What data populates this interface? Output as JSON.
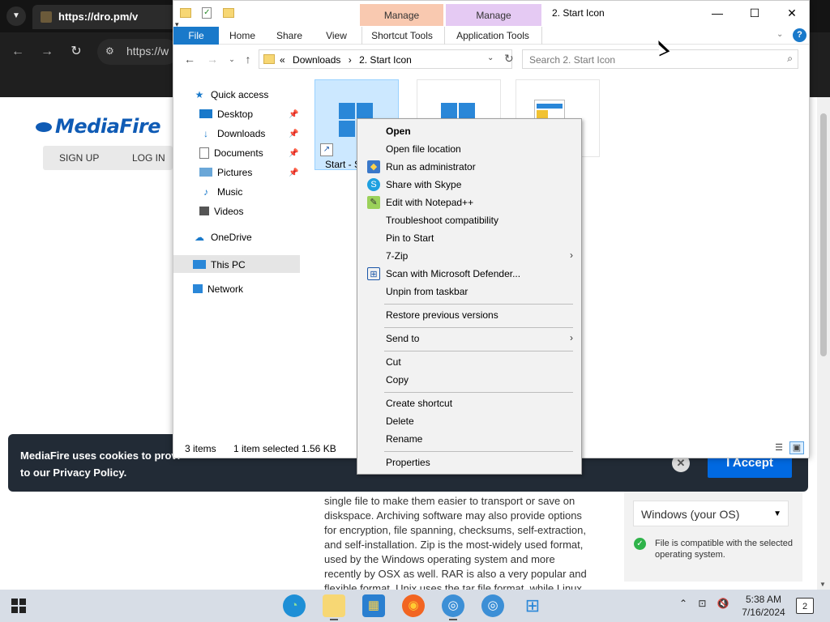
{
  "browser": {
    "tab_title": "https://dro.pm/v",
    "url": "https://w",
    "colors": {
      "tabbar": "#141414",
      "toolbar": "#1f1f1f"
    }
  },
  "mediafire": {
    "logo_text": "MediaFire",
    "nav": [
      "SIGN UP",
      "LOG IN"
    ],
    "article_lines": [
      "single file to make them easier to transport or save on",
      "diskspace. Archiving software may also provide options",
      "for encryption, file spanning, checksums, self-extraction,",
      "and self-installation. Zip is the most-widely used format,",
      "used by the Windows operating system and more",
      "recently by OSX as well. RAR is also a very popular and",
      "flexible format. Unix uses the tar file format, while Linux"
    ],
    "os_select": "Windows (your OS)",
    "os_note": "File is compatible with the selected operating system.",
    "cookie_text": "MediaFire uses cookies to provi... to our Privacy Policy.",
    "cookie_line1": "MediaFire uses cookies to provi",
    "cookie_line2": "to our Privacy Policy.",
    "accept_label": "I Accept",
    "colors": {
      "brand": "#0f5bb5",
      "accept": "#0069e1",
      "cookie_bg": "#222b36",
      "check": "#2fb34a"
    }
  },
  "explorer": {
    "window_title": "2. Start Icon",
    "context_tabs": [
      {
        "group": "Manage",
        "tab": "Shortcut Tools",
        "color": "#f9c9b0"
      },
      {
        "group": "Manage",
        "tab": "Application Tools",
        "color": "#e5caf3"
      }
    ],
    "ribbon_tabs": [
      "File",
      "Home",
      "Share",
      "View"
    ],
    "address_crumbs": [
      "«",
      "Downloads",
      "›",
      "2. Start Icon"
    ],
    "search_placeholder": "Search 2. Start Icon",
    "nav_items": [
      {
        "label": "Quick access",
        "icon": "star-icon"
      },
      {
        "label": "Desktop",
        "icon": "desktop-icon",
        "pinned": true
      },
      {
        "label": "Downloads",
        "icon": "download-icon",
        "pinned": true
      },
      {
        "label": "Documents",
        "icon": "documents-icon",
        "pinned": true
      },
      {
        "label": "Pictures",
        "icon": "pictures-icon",
        "pinned": true
      },
      {
        "label": "Music",
        "icon": "music-icon"
      },
      {
        "label": "Videos",
        "icon": "videos-icon"
      },
      {
        "label": "OneDrive",
        "icon": "cloud-icon"
      },
      {
        "label": "This PC",
        "icon": "pc-icon",
        "selected": true
      },
      {
        "label": "Network",
        "icon": "network-icon"
      }
    ],
    "files": [
      {
        "label": "Start - S",
        "icon": "windows-logo-icon",
        "selected": true,
        "shortcut": true
      },
      {
        "label": "",
        "icon": "windows-logo-icon"
      },
      {
        "label": "",
        "icon": "application-icon"
      }
    ],
    "status": {
      "items": "3 items",
      "selected": "1 item selected",
      "size": "1.56 KB"
    },
    "colors": {
      "file_tab": "#1979ca",
      "selection": "#cce8ff"
    }
  },
  "context_menu": {
    "groups": [
      [
        {
          "label": "Open",
          "bold": true
        },
        {
          "label": "Open file location"
        },
        {
          "label": "Run as administrator",
          "icon": "shield-icon"
        },
        {
          "label": "Share with Skype",
          "icon": "skype-icon"
        },
        {
          "label": "Edit with Notepad++",
          "icon": "notepadpp-icon"
        },
        {
          "label": "Troubleshoot compatibility"
        },
        {
          "label": "Pin to Start"
        },
        {
          "label": "7-Zip",
          "submenu": true
        },
        {
          "label": "Scan with Microsoft Defender...",
          "icon": "defender-icon"
        },
        {
          "label": "Unpin from taskbar"
        }
      ],
      [
        {
          "label": "Restore previous versions"
        }
      ],
      [
        {
          "label": "Send to",
          "submenu": true
        }
      ],
      [
        {
          "label": "Cut"
        },
        {
          "label": "Copy"
        }
      ],
      [
        {
          "label": "Create shortcut"
        },
        {
          "label": "Delete"
        },
        {
          "label": "Rename"
        }
      ],
      [
        {
          "label": "Properties"
        }
      ]
    ]
  },
  "taskbar": {
    "apps": [
      "edge-icon",
      "file-explorer-icon",
      "store-icon",
      "firefox-icon",
      "chrome-icon",
      "chrome-profile-icon",
      "start-menu-app-icon"
    ],
    "time": "5:38 AM",
    "date": "7/16/2024",
    "notification_count": "2"
  }
}
